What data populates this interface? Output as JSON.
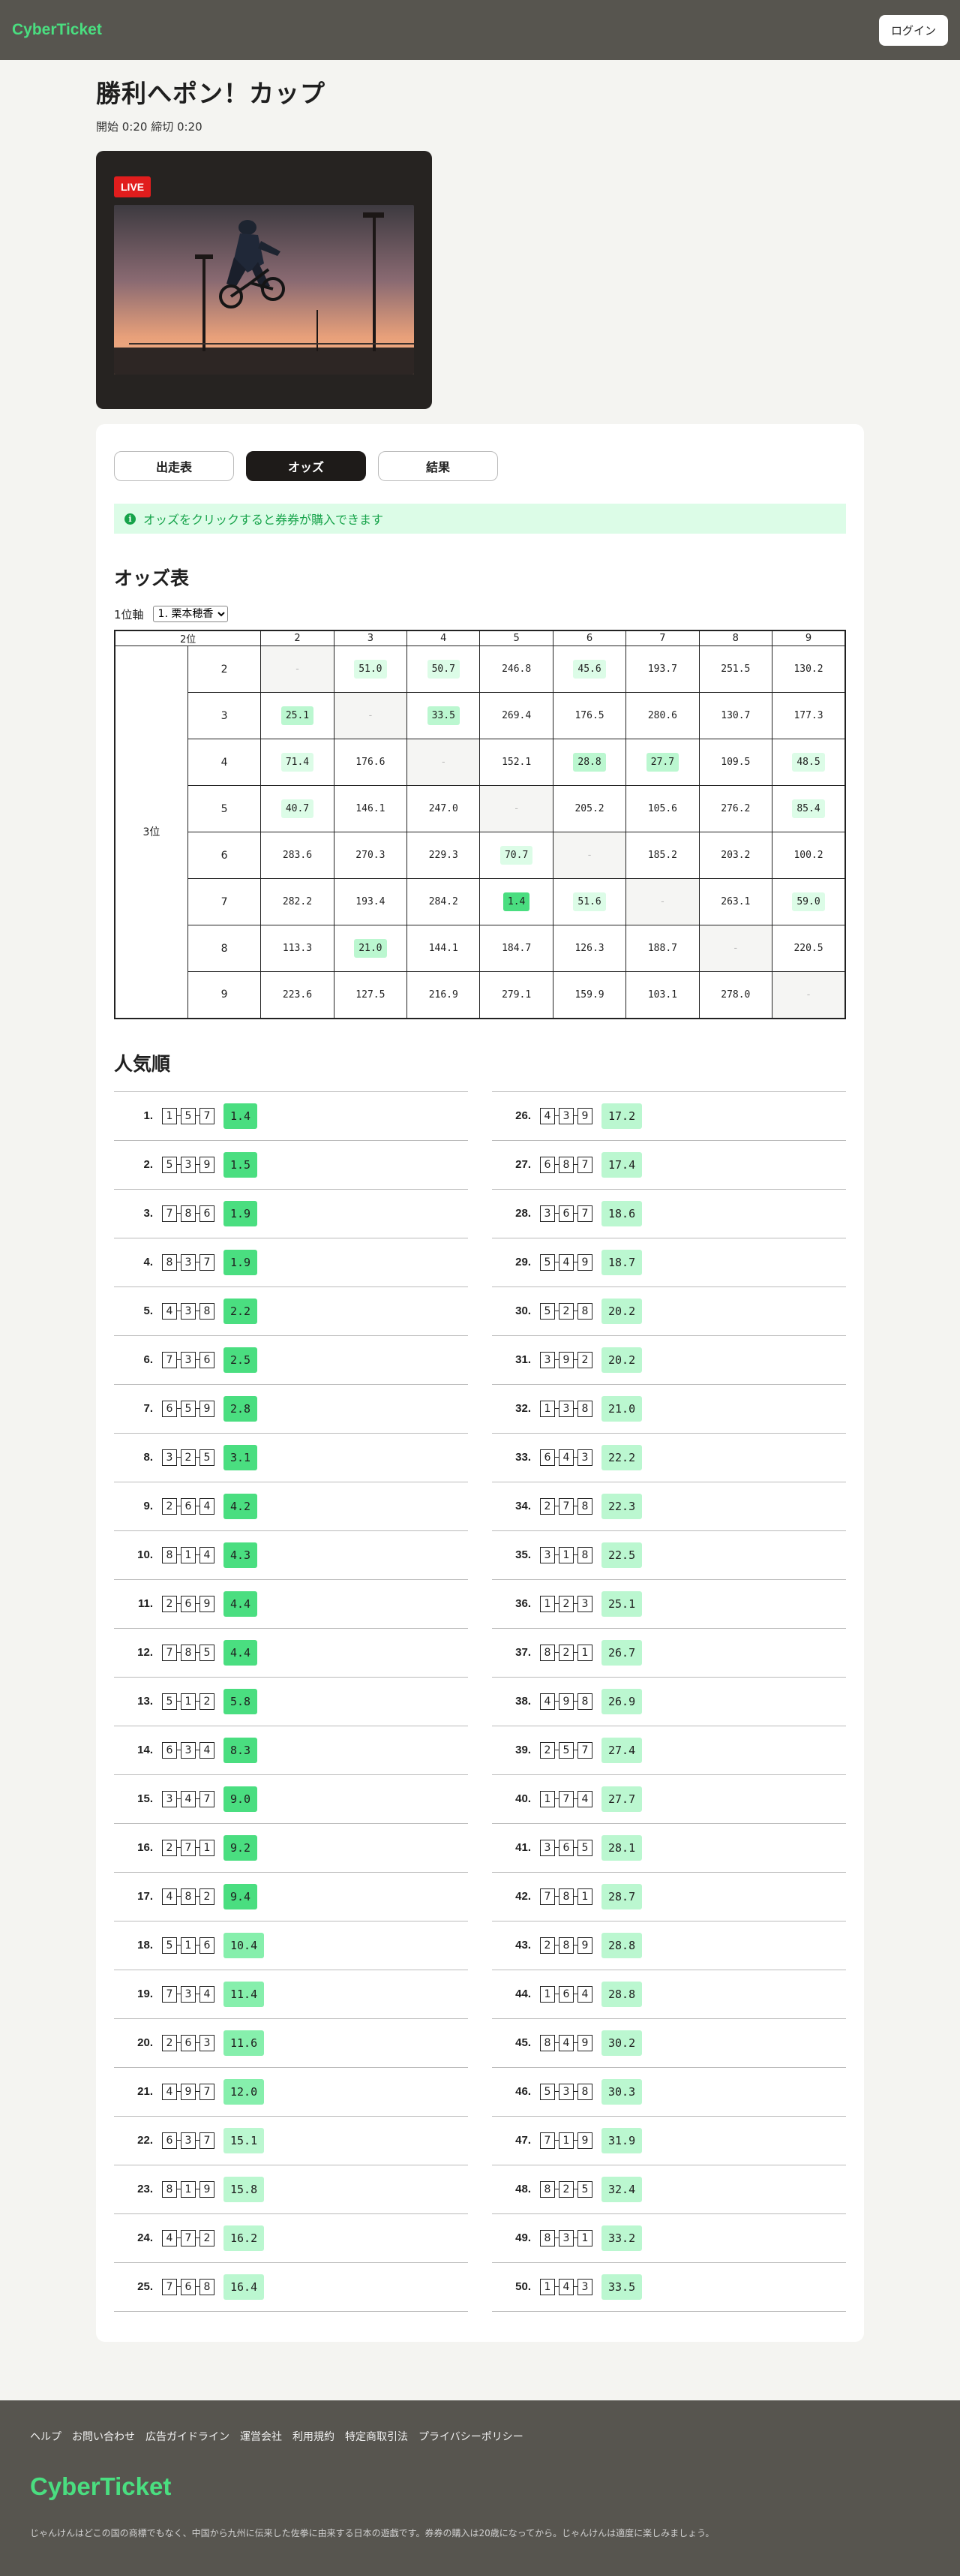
{
  "header": {
    "logo": "CyberTicket",
    "login_label": "ログイン"
  },
  "race": {
    "title": "勝利へポン！カップ",
    "time_info": "開始 0:20 締切 0:20",
    "live_label": "LIVE"
  },
  "tabs": [
    {
      "label": "出走表",
      "active": false
    },
    {
      "label": "オッズ",
      "active": true
    },
    {
      "label": "結果",
      "active": false
    }
  ],
  "notice": {
    "icon": "info-icon",
    "text": "オッズをクリックすると券券が購入できます"
  },
  "odds_table": {
    "title": "オッズ表",
    "axis_label": "1位軸",
    "axis_selected": "1. 栗本穂香",
    "corner_label": "2位",
    "third_label": "3位",
    "columns": [
      "2",
      "3",
      "4",
      "5",
      "6",
      "7",
      "8",
      "9"
    ],
    "rows": [
      {
        "label": "2",
        "cells": [
          "-",
          "51.0",
          "50.7",
          "246.8",
          "45.6",
          "193.7",
          "251.5",
          "130.2"
        ]
      },
      {
        "label": "3",
        "cells": [
          "25.1",
          "-",
          "33.5",
          "269.4",
          "176.5",
          "280.6",
          "130.7",
          "177.3"
        ]
      },
      {
        "label": "4",
        "cells": [
          "71.4",
          "176.6",
          "-",
          "152.1",
          "28.8",
          "27.7",
          "109.5",
          "48.5"
        ]
      },
      {
        "label": "5",
        "cells": [
          "40.7",
          "146.1",
          "247.0",
          "-",
          "205.2",
          "105.6",
          "276.2",
          "85.4"
        ]
      },
      {
        "label": "6",
        "cells": [
          "283.6",
          "270.3",
          "229.3",
          "70.7",
          "-",
          "185.2",
          "203.2",
          "100.2"
        ]
      },
      {
        "label": "7",
        "cells": [
          "282.2",
          "193.4",
          "284.2",
          "1.4",
          "51.6",
          "-",
          "263.1",
          "59.0"
        ]
      },
      {
        "label": "8",
        "cells": [
          "113.3",
          "21.0",
          "144.1",
          "184.7",
          "126.3",
          "188.7",
          "-",
          "220.5"
        ]
      },
      {
        "label": "9",
        "cells": [
          "223.6",
          "127.5",
          "216.9",
          "279.1",
          "159.9",
          "103.1",
          "278.0",
          "-"
        ]
      }
    ]
  },
  "popularity": {
    "title": "人気順",
    "items": [
      {
        "rank": "1.",
        "combo": [
          "1",
          "5",
          "7"
        ],
        "odds": "1.4"
      },
      {
        "rank": "2.",
        "combo": [
          "5",
          "3",
          "9"
        ],
        "odds": "1.5"
      },
      {
        "rank": "3.",
        "combo": [
          "7",
          "8",
          "6"
        ],
        "odds": "1.9"
      },
      {
        "rank": "4.",
        "combo": [
          "8",
          "3",
          "7"
        ],
        "odds": "1.9"
      },
      {
        "rank": "5.",
        "combo": [
          "4",
          "3",
          "8"
        ],
        "odds": "2.2"
      },
      {
        "rank": "6.",
        "combo": [
          "7",
          "3",
          "6"
        ],
        "odds": "2.5"
      },
      {
        "rank": "7.",
        "combo": [
          "6",
          "5",
          "9"
        ],
        "odds": "2.8"
      },
      {
        "rank": "8.",
        "combo": [
          "3",
          "2",
          "5"
        ],
        "odds": "3.1"
      },
      {
        "rank": "9.",
        "combo": [
          "2",
          "6",
          "4"
        ],
        "odds": "4.2"
      },
      {
        "rank": "10.",
        "combo": [
          "8",
          "1",
          "4"
        ],
        "odds": "4.3"
      },
      {
        "rank": "11.",
        "combo": [
          "2",
          "6",
          "9"
        ],
        "odds": "4.4"
      },
      {
        "rank": "12.",
        "combo": [
          "7",
          "8",
          "5"
        ],
        "odds": "4.4"
      },
      {
        "rank": "13.",
        "combo": [
          "5",
          "1",
          "2"
        ],
        "odds": "5.8"
      },
      {
        "rank": "14.",
        "combo": [
          "6",
          "3",
          "4"
        ],
        "odds": "8.3"
      },
      {
        "rank": "15.",
        "combo": [
          "3",
          "4",
          "7"
        ],
        "odds": "9.0"
      },
      {
        "rank": "16.",
        "combo": [
          "2",
          "7",
          "1"
        ],
        "odds": "9.2"
      },
      {
        "rank": "17.",
        "combo": [
          "4",
          "8",
          "2"
        ],
        "odds": "9.4"
      },
      {
        "rank": "18.",
        "combo": [
          "5",
          "1",
          "6"
        ],
        "odds": "10.4"
      },
      {
        "rank": "19.",
        "combo": [
          "7",
          "3",
          "4"
        ],
        "odds": "11.4"
      },
      {
        "rank": "20.",
        "combo": [
          "2",
          "6",
          "3"
        ],
        "odds": "11.6"
      },
      {
        "rank": "21.",
        "combo": [
          "4",
          "9",
          "7"
        ],
        "odds": "12.0"
      },
      {
        "rank": "22.",
        "combo": [
          "6",
          "3",
          "7"
        ],
        "odds": "15.1"
      },
      {
        "rank": "23.",
        "combo": [
          "8",
          "1",
          "9"
        ],
        "odds": "15.8"
      },
      {
        "rank": "24.",
        "combo": [
          "4",
          "7",
          "2"
        ],
        "odds": "16.2"
      },
      {
        "rank": "25.",
        "combo": [
          "7",
          "6",
          "8"
        ],
        "odds": "16.4"
      },
      {
        "rank": "26.",
        "combo": [
          "4",
          "3",
          "9"
        ],
        "odds": "17.2"
      },
      {
        "rank": "27.",
        "combo": [
          "6",
          "8",
          "7"
        ],
        "odds": "17.4"
      },
      {
        "rank": "28.",
        "combo": [
          "3",
          "6",
          "7"
        ],
        "odds": "18.6"
      },
      {
        "rank": "29.",
        "combo": [
          "5",
          "4",
          "9"
        ],
        "odds": "18.7"
      },
      {
        "rank": "30.",
        "combo": [
          "5",
          "2",
          "8"
        ],
        "odds": "20.2"
      },
      {
        "rank": "31.",
        "combo": [
          "3",
          "9",
          "2"
        ],
        "odds": "20.2"
      },
      {
        "rank": "32.",
        "combo": [
          "1",
          "3",
          "8"
        ],
        "odds": "21.0"
      },
      {
        "rank": "33.",
        "combo": [
          "6",
          "4",
          "3"
        ],
        "odds": "22.2"
      },
      {
        "rank": "34.",
        "combo": [
          "2",
          "7",
          "8"
        ],
        "odds": "22.3"
      },
      {
        "rank": "35.",
        "combo": [
          "3",
          "1",
          "8"
        ],
        "odds": "22.5"
      },
      {
        "rank": "36.",
        "combo": [
          "1",
          "2",
          "3"
        ],
        "odds": "25.1"
      },
      {
        "rank": "37.",
        "combo": [
          "8",
          "2",
          "1"
        ],
        "odds": "26.7"
      },
      {
        "rank": "38.",
        "combo": [
          "4",
          "9",
          "8"
        ],
        "odds": "26.9"
      },
      {
        "rank": "39.",
        "combo": [
          "2",
          "5",
          "7"
        ],
        "odds": "27.4"
      },
      {
        "rank": "40.",
        "combo": [
          "1",
          "7",
          "4"
        ],
        "odds": "27.7"
      },
      {
        "rank": "41.",
        "combo": [
          "3",
          "6",
          "5"
        ],
        "odds": "28.1"
      },
      {
        "rank": "42.",
        "combo": [
          "7",
          "8",
          "1"
        ],
        "odds": "28.7"
      },
      {
        "rank": "43.",
        "combo": [
          "2",
          "8",
          "9"
        ],
        "odds": "28.8"
      },
      {
        "rank": "44.",
        "combo": [
          "1",
          "6",
          "4"
        ],
        "odds": "28.8"
      },
      {
        "rank": "45.",
        "combo": [
          "8",
          "4",
          "9"
        ],
        "odds": "30.2"
      },
      {
        "rank": "46.",
        "combo": [
          "5",
          "3",
          "8"
        ],
        "odds": "30.3"
      },
      {
        "rank": "47.",
        "combo": [
          "7",
          "1",
          "9"
        ],
        "odds": "31.9"
      },
      {
        "rank": "48.",
        "combo": [
          "8",
          "2",
          "5"
        ],
        "odds": "32.4"
      },
      {
        "rank": "49.",
        "combo": [
          "8",
          "3",
          "1"
        ],
        "odds": "33.2"
      },
      {
        "rank": "50.",
        "combo": [
          "1",
          "4",
          "3"
        ],
        "odds": "33.5"
      }
    ]
  },
  "footer": {
    "links": [
      "ヘルプ",
      "お問い合わせ",
      "広告ガイドライン",
      "運営会社",
      "利用規約",
      "特定商取引法",
      "プライバシーポリシー"
    ],
    "logo": "CyberTicket",
    "note": "じゃんけんはどこの国の商標でもなく、中国から九州に伝来した佐拳に由来する日本の遊戯です。券券の購入は20歳になってから。じゃんけんは適度に楽しみましょう。"
  }
}
